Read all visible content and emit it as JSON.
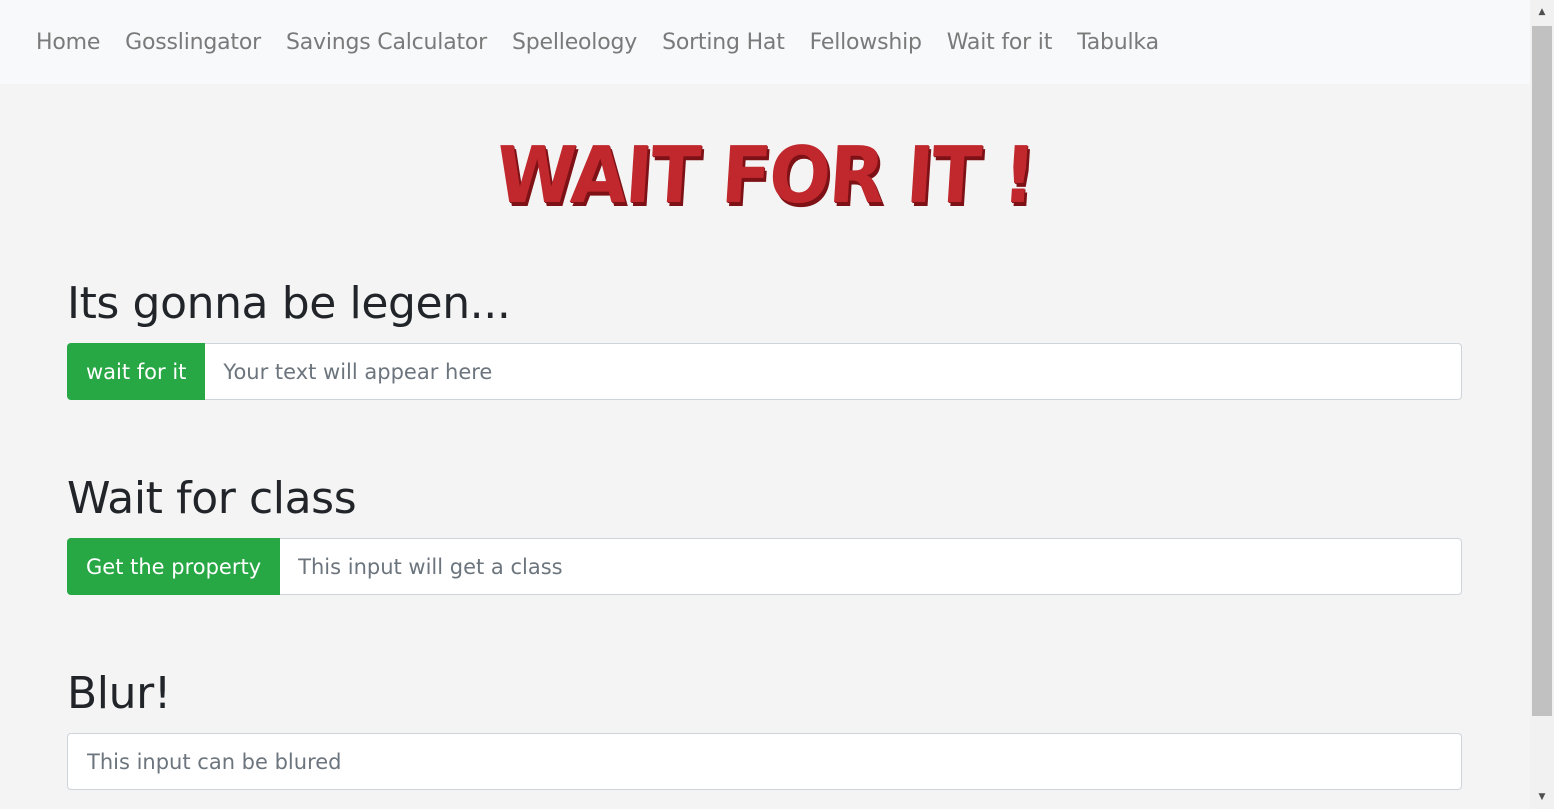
{
  "nav": {
    "items": [
      {
        "label": "Home"
      },
      {
        "label": "Gosslingator"
      },
      {
        "label": "Savings Calculator"
      },
      {
        "label": "Spelleology"
      },
      {
        "label": "Sorting Hat"
      },
      {
        "label": "Fellowship"
      },
      {
        "label": "Wait for it"
      },
      {
        "label": "Tabulka"
      }
    ]
  },
  "logo": {
    "text": "WAIT FOR IT !"
  },
  "sections": {
    "legendary": {
      "title": "Its gonna be legen...",
      "button_label": "wait for it",
      "input_placeholder": "Your text will appear here"
    },
    "wait_class": {
      "title": "Wait for class",
      "button_label": "Get the property",
      "input_placeholder": "This input will get a class"
    },
    "blur": {
      "title": "Blur!",
      "input_placeholder": "This input can be blured"
    }
  },
  "colors": {
    "accent_green": "#28a745",
    "logo_red": "#c0282d",
    "navbar_bg": "#f8f9fa",
    "page_bg": "#f4f4f4"
  },
  "scrollbar": {
    "up_icon": "triangle-up",
    "down_icon": "triangle-down"
  }
}
